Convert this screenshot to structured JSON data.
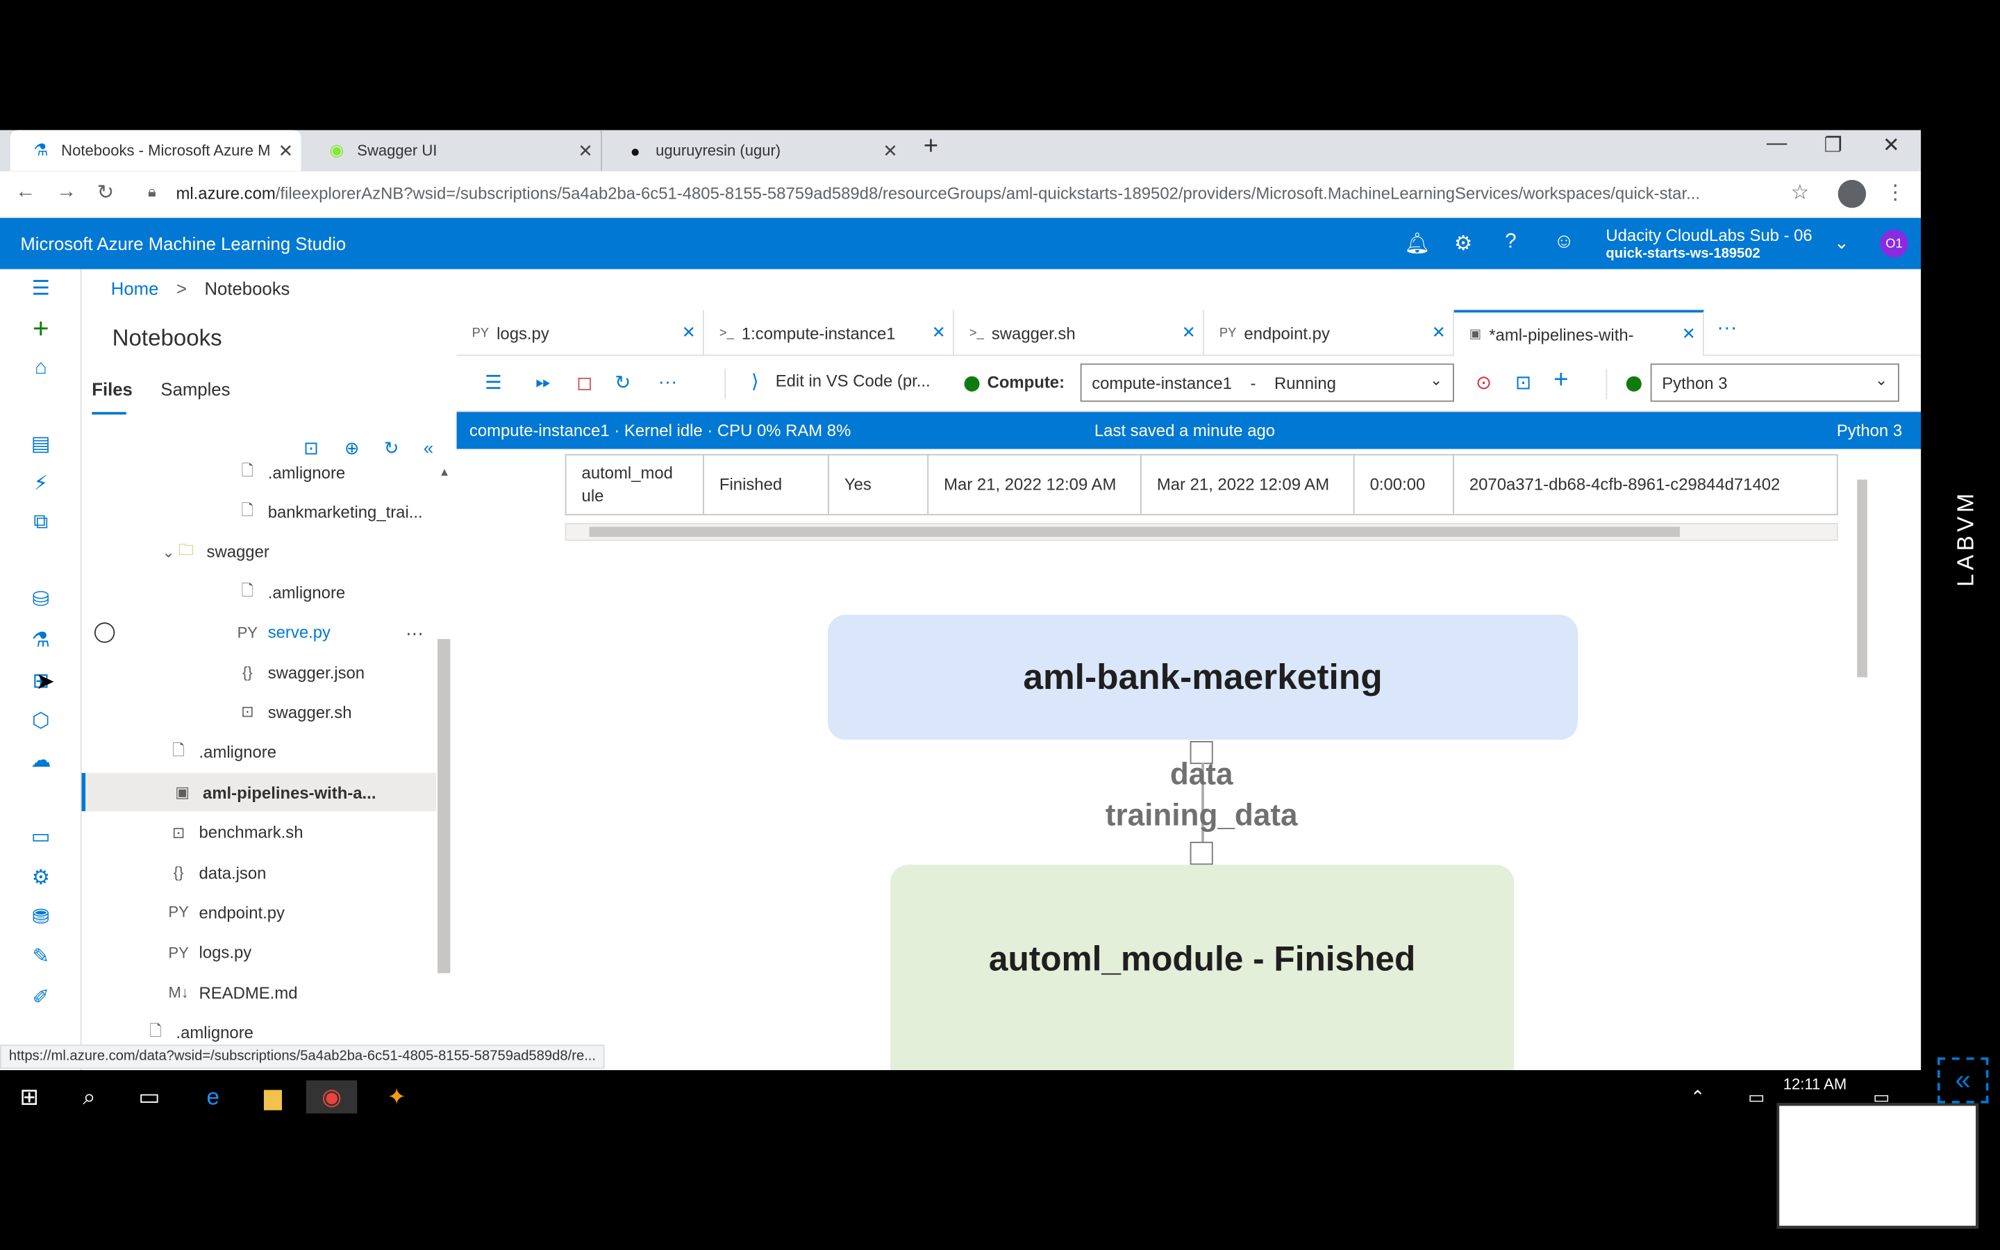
{
  "browser": {
    "tabs": [
      {
        "title": "Notebooks - Microsoft Azure Ma",
        "icon": "azure-ml-icon",
        "close": "✕"
      },
      {
        "title": "Swagger UI",
        "icon": "swagger-icon",
        "close": "✕"
      },
      {
        "title": "uguruyresin (ugur)",
        "icon": "github-icon",
        "close": "✕"
      }
    ],
    "new_tab": "+",
    "url_host": "ml.azure.com",
    "url_path": "/fileexplorerAzNB?wsid=/subscriptions/5a4ab2ba-6c51-4805-8155-58759ad589d8/resourceGroups/aml-quickstarts-189502/providers/Microsoft.MachineLearningServices/workspaces/quick-star..."
  },
  "header": {
    "title": "Microsoft Azure Machine Learning Studio",
    "account_name": "Udacity CloudLabs Sub - 06",
    "workspace": "quick-starts-ws-189502",
    "avatar_initials": "O1"
  },
  "breadcrumb": {
    "home": "Home",
    "sep": ">",
    "current": "Notebooks"
  },
  "notebooks": {
    "title": "Notebooks",
    "tab_files": "Files",
    "tab_samples": "Samples",
    "tree": [
      {
        "label": ".amlignore",
        "icon": "file-icon",
        "indent": 1
      },
      {
        "label": "bankmarketing_trai...",
        "icon": "file-icon",
        "indent": 1
      },
      {
        "label": "swagger",
        "icon": "folder-icon",
        "indent": 0.6,
        "expanded": true
      },
      {
        "label": ".amlignore",
        "icon": "file-icon",
        "indent": 1
      },
      {
        "label": "serve.py",
        "icon": "python-icon",
        "icon_text": "PY",
        "indent": 1,
        "hover": true,
        "more": "···"
      },
      {
        "label": "swagger.json",
        "icon": "json-icon",
        "icon_text": "{}",
        "indent": 1
      },
      {
        "label": "swagger.sh",
        "icon": "terminal-icon",
        "indent": 1
      },
      {
        "label": ".amlignore",
        "icon": "file-icon",
        "indent": 0.55
      },
      {
        "label": "aml-pipelines-with-a...",
        "icon": "notebook-icon",
        "indent": 0.55,
        "selected": true
      },
      {
        "label": "benchmark.sh",
        "icon": "terminal-icon",
        "indent": 0.55
      },
      {
        "label": "data.json",
        "icon": "json-icon",
        "icon_text": "{}",
        "indent": 0.55
      },
      {
        "label": "endpoint.py",
        "icon": "python-icon",
        "icon_text": "PY",
        "indent": 0.55
      },
      {
        "label": "logs.py",
        "icon": "python-icon",
        "icon_text": "PY",
        "indent": 0.55
      },
      {
        "label": "README.md",
        "icon": "markdown-icon",
        "icon_text": "M↓",
        "indent": 0.55
      },
      {
        "label": ".amlignore",
        "icon": "file-icon",
        "indent": 0.4
      }
    ]
  },
  "editor": {
    "tabs": [
      {
        "label": "logs.py",
        "icon_text": "PY"
      },
      {
        "label": "1:compute-instance1",
        "icon_text": ">_"
      },
      {
        "label": "swagger.sh",
        "icon_text": ">_"
      },
      {
        "label": "endpoint.py",
        "icon_text": "PY"
      },
      {
        "label": "*aml-pipelines-with-",
        "icon_text": "▣",
        "active": true
      }
    ],
    "more": "···",
    "toolbar": {
      "vscode_label": "Edit in VS Code (pr...",
      "compute_label": "Compute:",
      "compute_value": "compute-instance1    -    Running",
      "kernel_value": "Python 3"
    },
    "status": {
      "left": "compute-instance1 · Kernel idle · CPU  0%   RAM  8%",
      "center": "Last saved a minute ago",
      "right": "Python 3"
    }
  },
  "output": {
    "table_row": [
      "automl_mod ule",
      "Finished",
      "Yes",
      "Mar 21, 2022 12:09 AM",
      "Mar 21, 2022 12:09 AM",
      "0:00:00",
      "2070a371-db68-4cfb-8961-c29844d71402"
    ],
    "graph": {
      "node1": "aml-bank-maerketing",
      "edge_label1": "data",
      "edge_label2": "training_data",
      "node2": "automl_module - Finished"
    }
  },
  "hover_url": "https://ml.azure.com/data?wsid=/subscriptions/5a4ab2ba-6c51-4805-8155-58759ad589d8/re...",
  "taskbar": {
    "clock": "12:11 AM"
  },
  "side_label": "LABVM",
  "colors": {
    "azure_blue": "#0078d4",
    "node_blue": "#dae6f9",
    "node_green": "#e3efd9",
    "status_green": "#107c10"
  }
}
